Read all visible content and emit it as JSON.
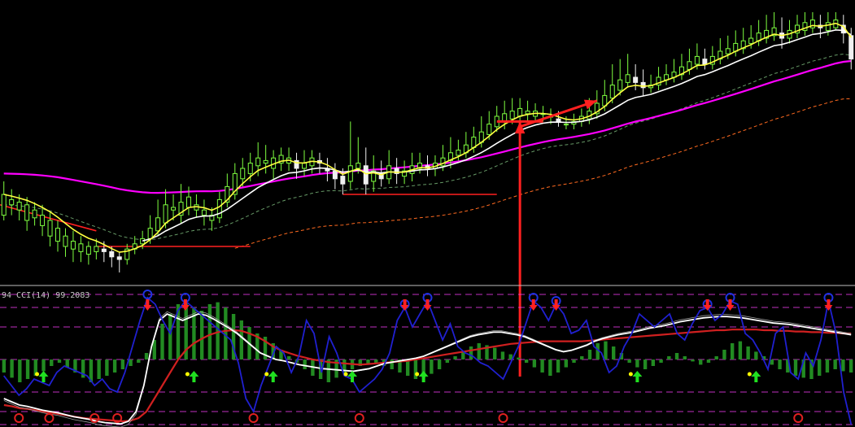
{
  "chart_data": [
    {
      "type": "candlestick",
      "title": "",
      "ylim": [
        0,
        100
      ],
      "candle_colors": {
        "up": "#7fff40",
        "down": "#f0f0f0"
      },
      "candles": [
        [
          22,
          30,
          35,
          20
        ],
        [
          26,
          28,
          32,
          22
        ],
        [
          24,
          27,
          30,
          20
        ],
        [
          20,
          26,
          29,
          16
        ],
        [
          21,
          24,
          27,
          18
        ],
        [
          18,
          22,
          26,
          14
        ],
        [
          14,
          20,
          23,
          10
        ],
        [
          12,
          17,
          20,
          8
        ],
        [
          10,
          14,
          17,
          6
        ],
        [
          9,
          12,
          16,
          4
        ],
        [
          8,
          11,
          14,
          4
        ],
        [
          7,
          10,
          12,
          3
        ],
        [
          8,
          10,
          13,
          5
        ],
        [
          9,
          8,
          12,
          4
        ],
        [
          8,
          6,
          10,
          2
        ],
        [
          6,
          5,
          8,
          0
        ],
        [
          5,
          9,
          11,
          3
        ],
        [
          9,
          11,
          14,
          7
        ],
        [
          11,
          13,
          16,
          9
        ],
        [
          13,
          17,
          22,
          11
        ],
        [
          16,
          21,
          28,
          14
        ],
        [
          19,
          26,
          32,
          17
        ],
        [
          24,
          25,
          30,
          20
        ],
        [
          22,
          27,
          34,
          19
        ],
        [
          25,
          29,
          33,
          22
        ],
        [
          24,
          26,
          30,
          21
        ],
        [
          22,
          24,
          28,
          18
        ],
        [
          20,
          22,
          25,
          16
        ],
        [
          21,
          28,
          31,
          19
        ],
        [
          27,
          33,
          38,
          25
        ],
        [
          30,
          38,
          42,
          28
        ],
        [
          36,
          40,
          44,
          33
        ],
        [
          38,
          42,
          46,
          35
        ],
        [
          41,
          44,
          50,
          37
        ],
        [
          42,
          43,
          49,
          38
        ],
        [
          40,
          44,
          47,
          36
        ],
        [
          42,
          45,
          48,
          39
        ],
        [
          42,
          44,
          48,
          39
        ],
        [
          43,
          40,
          46,
          36
        ],
        [
          40,
          42,
          47,
          37
        ],
        [
          41,
          44,
          47,
          38
        ],
        [
          43,
          42,
          46,
          38
        ],
        [
          40,
          39,
          44,
          35
        ],
        [
          39,
          36,
          42,
          32
        ],
        [
          37,
          34,
          40,
          30
        ],
        [
          35,
          41,
          58,
          32
        ],
        [
          40,
          42,
          52,
          38
        ],
        [
          41,
          34,
          48,
          30
        ],
        [
          35,
          39,
          45,
          31
        ],
        [
          38,
          36,
          43,
          33
        ],
        [
          36,
          41,
          47,
          34
        ],
        [
          40,
          38,
          44,
          34
        ],
        [
          37,
          39,
          43,
          34
        ],
        [
          38,
          41,
          46,
          35
        ],
        [
          40,
          42,
          46,
          38
        ],
        [
          41,
          40,
          45,
          37
        ],
        [
          40,
          42,
          45,
          37
        ],
        [
          41,
          44,
          49,
          39
        ],
        [
          43,
          46,
          52,
          40
        ],
        [
          45,
          47,
          51,
          43
        ],
        [
          46,
          49,
          54,
          44
        ],
        [
          48,
          52,
          56,
          46
        ],
        [
          50,
          54,
          60,
          48
        ],
        [
          53,
          57,
          62,
          51
        ],
        [
          56,
          60,
          64,
          54
        ],
        [
          58,
          61,
          66,
          55
        ],
        [
          59,
          62,
          67,
          57
        ],
        [
          60,
          63,
          67,
          58
        ],
        [
          61,
          62,
          66,
          58
        ],
        [
          60,
          62,
          65,
          58
        ],
        [
          61,
          61,
          64,
          58
        ],
        [
          60,
          60,
          63,
          57
        ],
        [
          59,
          58,
          62,
          56
        ],
        [
          57,
          57,
          60,
          55
        ],
        [
          57,
          58,
          61,
          55
        ],
        [
          58,
          60,
          63,
          56
        ],
        [
          59,
          62,
          67,
          57
        ],
        [
          61,
          65,
          70,
          59
        ],
        [
          64,
          68,
          74,
          62
        ],
        [
          67,
          72,
          80,
          65
        ],
        [
          70,
          74,
          82,
          68
        ],
        [
          73,
          76,
          84,
          71
        ],
        [
          75,
          73,
          80,
          70
        ],
        [
          73,
          71,
          78,
          68
        ],
        [
          71,
          72,
          76,
          69
        ],
        [
          72,
          75,
          79,
          70
        ],
        [
          74,
          76,
          80,
          72
        ],
        [
          75,
          77,
          82,
          73
        ],
        [
          76,
          79,
          84,
          74
        ],
        [
          78,
          81,
          86,
          76
        ],
        [
          80,
          83,
          88,
          78
        ],
        [
          82,
          80,
          86,
          78
        ],
        [
          80,
          83,
          87,
          78
        ],
        [
          82,
          85,
          90,
          80
        ],
        [
          84,
          86,
          91,
          82
        ],
        [
          85,
          88,
          93,
          83
        ],
        [
          86,
          89,
          94,
          84
        ],
        [
          88,
          90,
          95,
          86
        ],
        [
          89,
          92,
          97,
          87
        ],
        [
          90,
          93,
          99,
          88
        ],
        [
          91,
          94,
          100,
          89
        ],
        [
          92,
          90,
          98,
          86
        ],
        [
          90,
          93,
          97,
          88
        ],
        [
          92,
          95,
          99,
          90
        ],
        [
          93,
          96,
          100,
          91
        ],
        [
          94,
          97,
          100,
          92
        ],
        [
          95,
          94,
          99,
          90
        ],
        [
          93,
          96,
          100,
          91
        ],
        [
          94,
          97,
          100,
          93
        ],
        [
          95,
          92,
          99,
          88
        ],
        [
          91,
          82,
          94,
          78
        ]
      ],
      "overlays": [
        {
          "color": "#ffff40",
          "kind": "ema_fast"
        },
        {
          "color": "#ffffff",
          "kind": "ema_mid"
        },
        {
          "color": "#ff00ff",
          "kind": "ema_slow"
        },
        {
          "color": "#ff2020",
          "kind": "trail_stop"
        },
        {
          "color": "#ff6a20",
          "kind": "dashed_band"
        },
        {
          "color": "#7fbf7f",
          "kind": "dashed_band"
        }
      ],
      "annotations": [
        {
          "shape": "arrow",
          "color": "#ff2020",
          "from": [
            67,
            56
          ],
          "to": [
            77,
            66
          ]
        },
        {
          "shape": "arrow",
          "color": "#ff2020",
          "from": [
            67,
            -40
          ],
          "to": [
            67,
            58
          ]
        },
        {
          "shape": "line",
          "color": "#ff2020",
          "from": [
            64,
            58
          ],
          "to": [
            70,
            58
          ]
        }
      ]
    },
    {
      "type": "oscillator",
      "legend_text": "94  CCI(14) 99.2083",
      "ylim": [
        -100,
        100
      ],
      "histogram_color": "#228b22",
      "histogram": [
        -20,
        -28,
        -35,
        -30,
        -25,
        -18,
        -10,
        -5,
        -12,
        -20,
        -28,
        -35,
        -30,
        -25,
        -20,
        -15,
        -10,
        -5,
        10,
        30,
        55,
        70,
        85,
        90,
        80,
        75,
        85,
        88,
        80,
        70,
        60,
        50,
        40,
        35,
        25,
        15,
        5,
        -5,
        -15,
        -25,
        -30,
        -35,
        -28,
        -20,
        -15,
        -10,
        -8,
        -5,
        -10,
        -15,
        -20,
        -25,
        -30,
        -28,
        -22,
        -15,
        -5,
        5,
        12,
        20,
        25,
        22,
        18,
        12,
        8,
        3,
        -5,
        -12,
        -20,
        -25,
        -20,
        -12,
        -5,
        5,
        15,
        25,
        28,
        20,
        10,
        -5,
        -12,
        -15,
        -10,
        -5,
        5,
        10,
        5,
        -3,
        -8,
        -5,
        5,
        15,
        25,
        28,
        20,
        12,
        5,
        -8,
        -15,
        -20,
        -25,
        -28,
        -30,
        -25,
        -20,
        -15,
        -18,
        -20
      ],
      "series": [
        {
          "color": "#2020d0",
          "values": [
            -25,
            -40,
            -55,
            -45,
            -30,
            -35,
            -40,
            -20,
            -10,
            -15,
            -20,
            -25,
            -40,
            -30,
            -45,
            -50,
            -20,
            20,
            60,
            95,
            85,
            60,
            40,
            75,
            90,
            80,
            70,
            60,
            50,
            40,
            30,
            -5,
            -60,
            -80,
            -40,
            -10,
            20,
            10,
            -20,
            5,
            60,
            40,
            -20,
            35,
            10,
            -25,
            -30,
            -50,
            -40,
            -30,
            -15,
            10,
            60,
            80,
            50,
            70,
            90,
            60,
            30,
            55,
            20,
            10,
            5,
            -5,
            -10,
            -20,
            -30,
            -5,
            20,
            55,
            90,
            80,
            60,
            85,
            70,
            40,
            45,
            60,
            20,
            10,
            -20,
            -10,
            20,
            40,
            70,
            60,
            50,
            60,
            70,
            40,
            30,
            55,
            75,
            80,
            60,
            70,
            90,
            85,
            40,
            30,
            10,
            -15,
            40,
            50,
            -20,
            -30,
            10,
            -10,
            30,
            90,
            40,
            -50,
            -100
          ]
        },
        {
          "color": "#ffffff",
          "values": [
            -60,
            -65,
            -70,
            -72,
            -75,
            -78,
            -80,
            -82,
            -85,
            -88,
            -90,
            -92,
            -95,
            -97,
            -98,
            -99,
            -95,
            -80,
            -40,
            20,
            60,
            70,
            65,
            60,
            65,
            70,
            68,
            62,
            55,
            48,
            40,
            30,
            20,
            10,
            5,
            0,
            -2,
            -5,
            -8,
            -10,
            -12,
            -14,
            -15,
            -16,
            -17,
            -18,
            -16,
            -14,
            -10,
            -6,
            -4,
            -2,
            0,
            2,
            5,
            10,
            15,
            20,
            25,
            30,
            35,
            38,
            40,
            42,
            42,
            40,
            38,
            35,
            30,
            25,
            20,
            15,
            12,
            14,
            18,
            22,
            28,
            32,
            35,
            38,
            40,
            42,
            45,
            48,
            50,
            52,
            55,
            58,
            60,
            62,
            64,
            65,
            66,
            66,
            65,
            64,
            62,
            60,
            58,
            56,
            55,
            54,
            52,
            50,
            48,
            46,
            44,
            42,
            40,
            38
          ]
        },
        {
          "color": "#d02020",
          "values": [
            -70,
            -72,
            -75,
            -76,
            -78,
            -80,
            -82,
            -84,
            -86,
            -88,
            -90,
            -91,
            -92,
            -93,
            -94,
            -95,
            -94,
            -90,
            -80,
            -60,
            -40,
            -20,
            0,
            15,
            25,
            32,
            38,
            42,
            44,
            45,
            44,
            40,
            35,
            28,
            20,
            14,
            10,
            6,
            3,
            0,
            -2,
            -4,
            -5,
            -6,
            -7,
            -8,
            -7,
            -6,
            -5,
            -4,
            -3,
            -2,
            0,
            2,
            4,
            6,
            8,
            10,
            12,
            14,
            16,
            18,
            20,
            22,
            24,
            25,
            26,
            27,
            28,
            28,
            28,
            28,
            28,
            28,
            29,
            30,
            31,
            32,
            33,
            34,
            35,
            36,
            37,
            38,
            39,
            40,
            41,
            42,
            43,
            44,
            45,
            45,
            46,
            46,
            46,
            46,
            45,
            45,
            44,
            44,
            43,
            43,
            42,
            42,
            41,
            41,
            40,
            40
          ]
        }
      ],
      "levels": [
        -100,
        -80,
        -50,
        0,
        50,
        80,
        100
      ],
      "level_color": "#ff40ff"
    }
  ]
}
